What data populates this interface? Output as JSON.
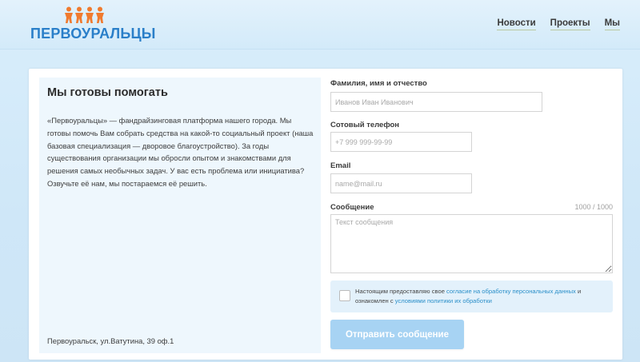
{
  "header": {
    "logo_text": "ПЕРВОУРАЛЬЦЫ",
    "nav": [
      {
        "label": "Новости"
      },
      {
        "label": "Проекты"
      },
      {
        "label": "Мы"
      }
    ]
  },
  "info": {
    "title": "Мы готовы помогать",
    "text": "«Первоуральцы» — фандрайзинговая платформа нашего города. Мы готовы помочь Вам собрать средства на какой-то социальный проект (наша базовая специализация — дворовое благоустройство). За годы существования организации мы обросли опытом и знакомствами для решения самых необычных задач. У вас есть проблема или инициатива? Озвучьте её нам, мы постараемся её решить.",
    "address": "Первоуральск, ул.Ватутина, 39 оф.1"
  },
  "form": {
    "name_label": "Фамилия, имя и отчество",
    "name_placeholder": "Иванов Иван Иванович",
    "phone_label": "Сотовый телефон",
    "phone_placeholder": "+7 999 999-99-99",
    "email_label": "Email",
    "email_placeholder": "name@mail.ru",
    "message_label": "Сообщение",
    "message_counter": "1000 / 1000",
    "message_placeholder": "Текст сообщения",
    "consent_prefix": "Настоящим предоставляю свое",
    "consent_link1": "согласие на обработку персональных данных",
    "consent_middle": "и ознакомлен с",
    "consent_link2": "условиями политики их обработки",
    "submit_label": "Отправить сообщение"
  },
  "colors": {
    "accent": "#2a7fc9",
    "logo_people": "#f07a2e",
    "submit_bg": "#a7d3f3",
    "link": "#2a8fc9"
  }
}
